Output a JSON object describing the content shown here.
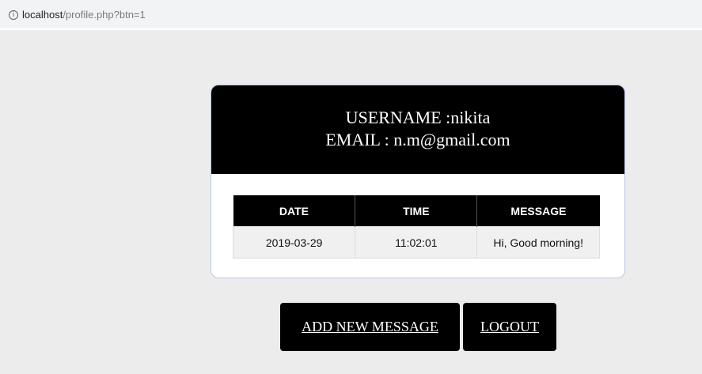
{
  "browser": {
    "url_host": "localhost",
    "url_path": "/profile.php?btn=1",
    "info_icon": "info-icon"
  },
  "profile": {
    "username_line": "USERNAME :nikita",
    "email_line": "EMAIL : n.m@gmail.com"
  },
  "messages_table": {
    "headers": [
      "DATE",
      "TIME",
      "MESSAGE"
    ],
    "rows": [
      [
        "2019-03-29",
        "11:02:01",
        "Hi, Good morning!"
      ]
    ]
  },
  "actions": {
    "add_message_label": "ADD NEW MESSAGE",
    "logout_label": "LOGOUT"
  },
  "colors": {
    "header_bg": "#000000",
    "page_bg": "#ececec",
    "card_border": "#b9c8e6"
  }
}
